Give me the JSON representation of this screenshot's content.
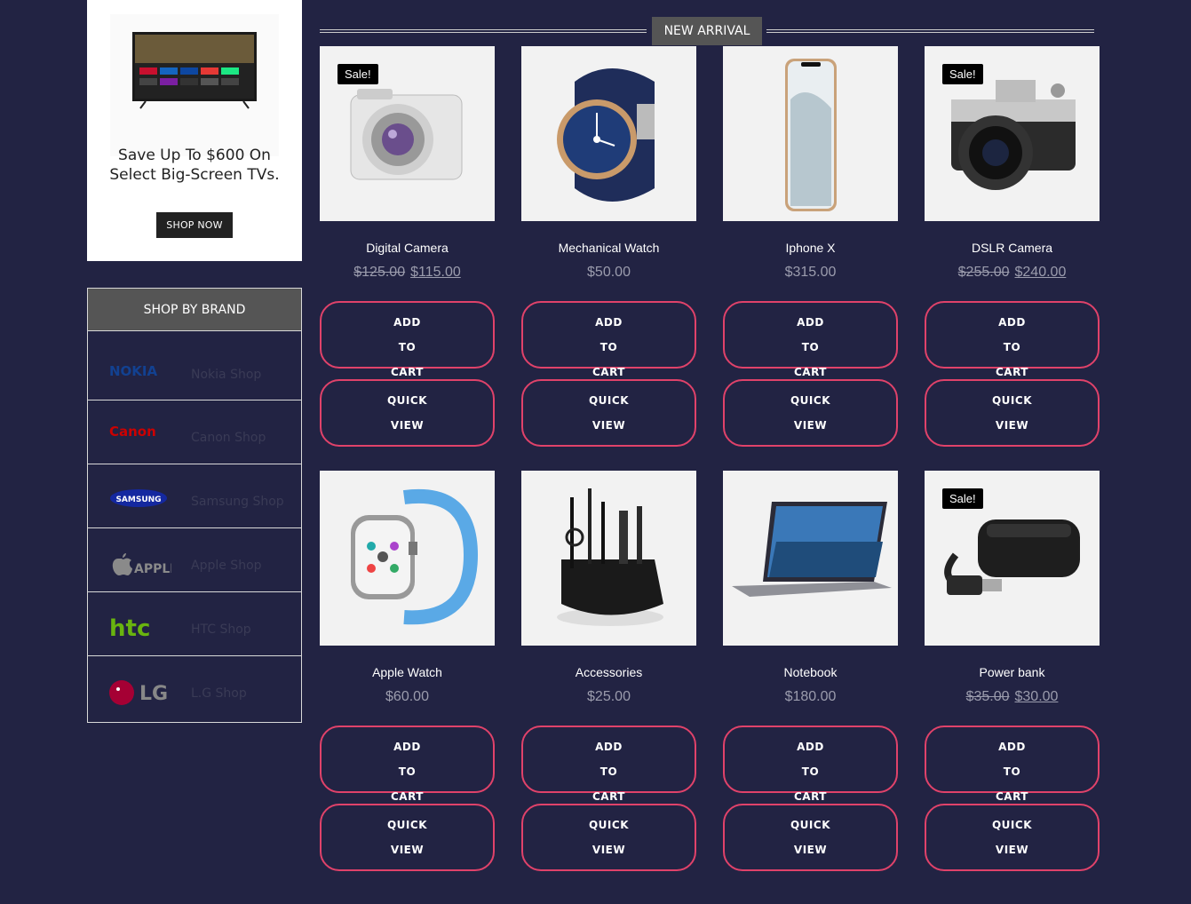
{
  "promo": {
    "text_line1": "Save Up To $600 On",
    "text_line2": "Select Big-Screen TVs.",
    "button": "SHOP NOW"
  },
  "brands": {
    "title": "SHOP BY BRAND",
    "items": [
      {
        "logo": "NOKIA",
        "label": "Nokia Shop",
        "color": "#124191"
      },
      {
        "logo": "Canon",
        "label": "Canon Shop",
        "color": "#cc0000"
      },
      {
        "logo": "SAMSUNG",
        "label": "Samsung Shop",
        "color": "#1428a0"
      },
      {
        "logo": "APPLE",
        "label": "Apple Shop",
        "color": "#8a8a8a"
      },
      {
        "logo": "htc",
        "label": "HTC Shop",
        "color": "#69b40f"
      },
      {
        "logo": "LG",
        "label": "L.G Shop",
        "color": "#a50034"
      }
    ]
  },
  "section": {
    "title": "NEW ARRIVAL"
  },
  "buttons": {
    "add": "ADD TO CART",
    "quick": "QUICK VIEW"
  },
  "sale_label": "Sale!",
  "products": [
    {
      "name": "Digital Camera",
      "old_price": "$125.00",
      "price": "$115.00",
      "sale": true,
      "icon": "camera-icon"
    },
    {
      "name": "Mechanical Watch",
      "old_price": "",
      "price": "$50.00",
      "sale": false,
      "icon": "watch-icon"
    },
    {
      "name": "Iphone X",
      "old_price": "",
      "price": "$315.00",
      "sale": false,
      "icon": "phone-icon"
    },
    {
      "name": "DSLR Camera",
      "old_price": "$255.00",
      "price": "$240.00",
      "sale": true,
      "icon": "dslr-icon"
    },
    {
      "name": "Apple Watch",
      "old_price": "",
      "price": "$60.00",
      "sale": false,
      "icon": "smartwatch-icon"
    },
    {
      "name": "Accessories",
      "old_price": "",
      "price": "$25.00",
      "sale": false,
      "icon": "desk-organizer-icon"
    },
    {
      "name": "Notebook",
      "old_price": "",
      "price": "$180.00",
      "sale": false,
      "icon": "laptop-icon"
    },
    {
      "name": "Power bank",
      "old_price": "$35.00",
      "price": "$30.00",
      "sale": true,
      "icon": "power-bank-icon"
    }
  ]
}
